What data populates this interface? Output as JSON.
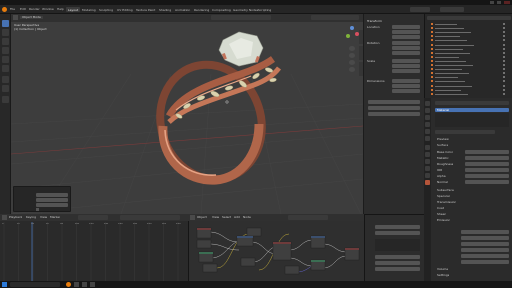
{
  "app": {
    "title": "",
    "menu": [
      "File",
      "Edit",
      "Render",
      "Window",
      "Help"
    ],
    "workspace_tabs": [
      "Layout",
      "Modeling",
      "Sculpting",
      "UV Editing",
      "Texture Paint",
      "Shading",
      "Animation",
      "Rendering",
      "Compositing",
      "Geometry Nodes",
      "Scripting"
    ],
    "active_workspace_index": 0
  },
  "viewport": {
    "mode_label": "Object Mode",
    "view_label": "User Perspective",
    "collection_label": "(1) Collection | Object",
    "subject": "rose-gold-ring-with-leaves-and-gem",
    "colors": {
      "background": "#3d3d3d",
      "ring_metal": "#b0664a",
      "ring_highlight": "#e6a283",
      "gem": "#d6dbd0",
      "leaf": "#d9d2ae"
    }
  },
  "last_operator": {
    "title": "",
    "rows": [
      "",
      "",
      "",
      ""
    ]
  },
  "npanel": {
    "sections": [
      "Item",
      "Transform",
      "Dimensions"
    ],
    "labels": [
      "Location",
      "Rotation",
      "Scale",
      "Dimensions"
    ]
  },
  "outliner": {
    "row_count": 18
  },
  "properties": {
    "material_slot": "Material",
    "panels": [
      "Preview",
      "Surface",
      "Volume",
      "Settings"
    ],
    "labels": [
      "Base Color",
      "Metallic",
      "Roughness",
      "IOR",
      "Alpha",
      "Normal",
      "Subsurface",
      "Specular",
      "Transmission",
      "Coat",
      "Sheen",
      "Emission"
    ]
  },
  "timeline": {
    "playback_label": "Playback",
    "keying_label": "Keying",
    "view_label": "View",
    "marker_label": "Marker",
    "frame_ticks": [
      "0",
      "20",
      "40",
      "60",
      "80",
      "100",
      "120",
      "140",
      "160",
      "180",
      "200",
      "220",
      "240"
    ],
    "current_frame": 1
  },
  "node_editor": {
    "editor_label": "Object",
    "view_label": "View",
    "select_label": "Select",
    "add_label": "Add",
    "node_label": "Node",
    "material_label": "Material",
    "node_count": 12
  },
  "status": {
    "taskbar_time": "",
    "weather": ""
  }
}
